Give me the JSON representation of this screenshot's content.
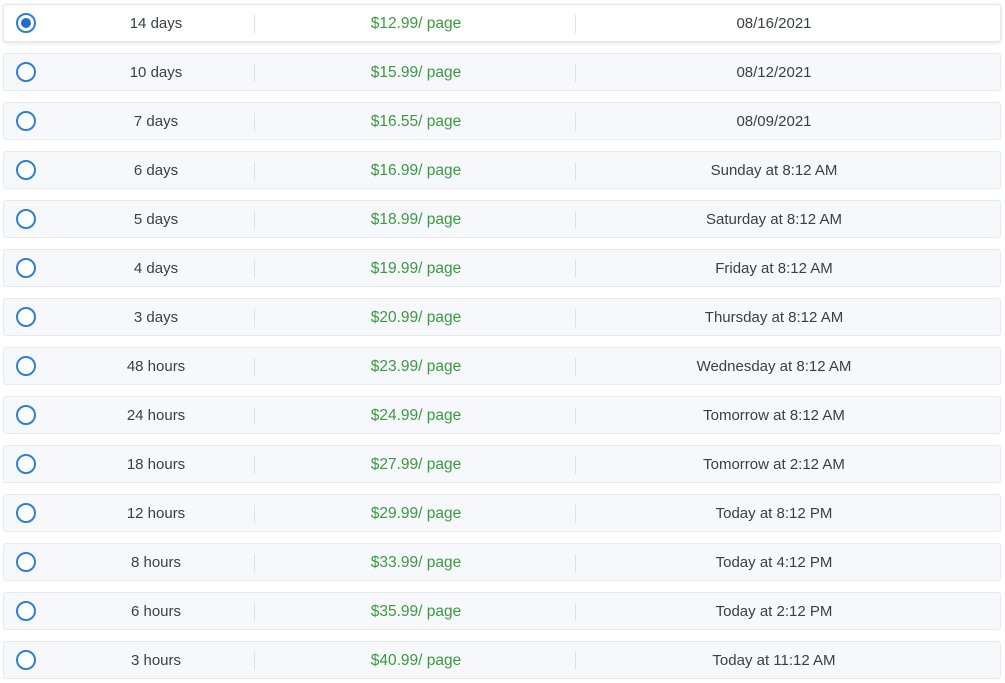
{
  "rows": [
    {
      "term": "14 days",
      "price": "$12.99/ page",
      "deadline": "08/16/2021",
      "selected": true
    },
    {
      "term": "10 days",
      "price": "$15.99/ page",
      "deadline": "08/12/2021",
      "selected": false
    },
    {
      "term": "7 days",
      "price": "$16.55/ page",
      "deadline": "08/09/2021",
      "selected": false
    },
    {
      "term": "6 days",
      "price": "$16.99/ page",
      "deadline": "Sunday at 8:12 AM",
      "selected": false
    },
    {
      "term": "5 days",
      "price": "$18.99/ page",
      "deadline": "Saturday at 8:12 AM",
      "selected": false
    },
    {
      "term": "4 days",
      "price": "$19.99/ page",
      "deadline": "Friday at 8:12 AM",
      "selected": false
    },
    {
      "term": "3 days",
      "price": "$20.99/ page",
      "deadline": "Thursday at 8:12 AM",
      "selected": false
    },
    {
      "term": "48 hours",
      "price": "$23.99/ page",
      "deadline": "Wednesday at 8:12 AM",
      "selected": false
    },
    {
      "term": "24 hours",
      "price": "$24.99/ page",
      "deadline": "Tomorrow at 8:12 AM",
      "selected": false
    },
    {
      "term": "18 hours",
      "price": "$27.99/ page",
      "deadline": "Tomorrow at 2:12 AM",
      "selected": false
    },
    {
      "term": "12 hours",
      "price": "$29.99/ page",
      "deadline": "Today at 8:12 PM",
      "selected": false
    },
    {
      "term": "8 hours",
      "price": "$33.99/ page",
      "deadline": "Today at 4:12 PM",
      "selected": false
    },
    {
      "term": "6 hours",
      "price": "$35.99/ page",
      "deadline": "Today at 2:12 PM",
      "selected": false
    },
    {
      "term": "3 hours",
      "price": "$40.99/ page",
      "deadline": "Today at 11:12 AM",
      "selected": false
    }
  ],
  "colors": {
    "radio_accent": "#1f6fd0",
    "price_text": "#3a9b3e"
  }
}
